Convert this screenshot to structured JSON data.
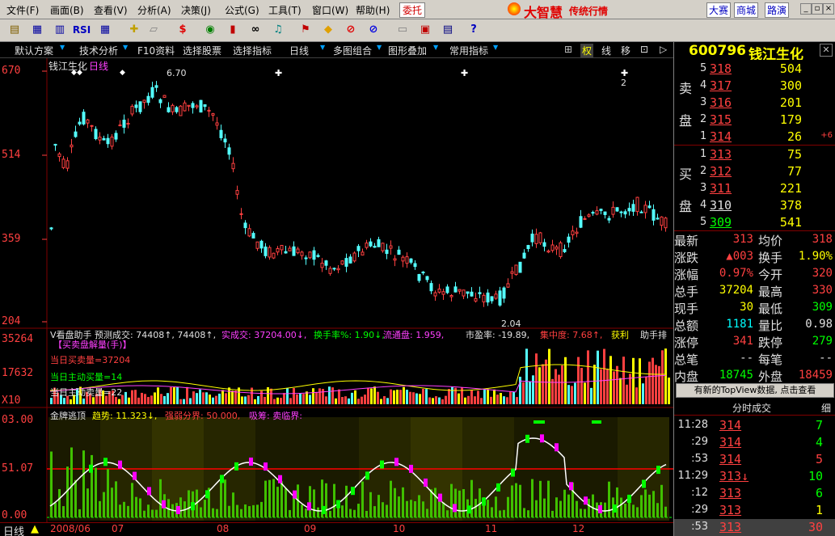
{
  "menu": [
    "文件(F)",
    "画面(B)",
    "查看(V)",
    "分析(A)",
    "决策(J)",
    "公式(G)",
    "工具(T)",
    "窗口(W)",
    "帮助(H)"
  ],
  "menu_entrust": "委托",
  "brand": "大智慧",
  "brand_sub": "传统行情",
  "menu_right": [
    "大赛",
    "商城",
    "路演"
  ],
  "toolbar_rsi": "RSI",
  "funcbar": [
    "默认方案",
    "技术分析",
    "F10资料",
    "选择股票",
    "选择指标",
    "日线",
    "多图组合",
    "图形叠加",
    "常用指标"
  ],
  "funcbar_right": [
    "⊞",
    "权",
    "线",
    "移",
    "⊡",
    "▷"
  ],
  "stock": {
    "code": "600796",
    "name": "钱江生化"
  },
  "chart": {
    "title_name": "钱江生化",
    "title_period": "日线",
    "y_labels": [
      "670",
      "514",
      "359",
      "204"
    ],
    "high_label": "6.70",
    "low_label": "2.04",
    "marker_2": "2"
  },
  "vol_panel": {
    "y_labels": [
      "35264",
      "17632",
      "X10"
    ],
    "header": [
      "V看盘助手 预测成交: 74408↑, 74408↑,",
      "实成交: 37204.00↓,",
      "换手率%: 1.90↓,",
      "流通盘: 1.959,",
      "市盈率: -19.89,",
      "集中度: 7.68↑,",
      "获利",
      "助手排"
    ],
    "lines": [
      "【买卖盘解量(手)】",
      "当日买卖量=37204",
      "当日主动买量=14",
      "当日主动卖量=22"
    ]
  },
  "ind_panel": {
    "y_labels": [
      "03.00",
      "51.07",
      "0.00"
    ],
    "header": [
      "金牌逃顶",
      "趋势: 11.323↓,",
      "强弱分界: 50.000,",
      "吸筹: 卖临界:"
    ]
  },
  "x_labels": [
    "2008/06",
    "07",
    "08",
    "09",
    "10",
    "11",
    "12"
  ],
  "status_left": "日线",
  "orderbook": {
    "sell_label": [
      "卖",
      "盘"
    ],
    "buy_label": [
      "买",
      "盘"
    ],
    "sell": [
      {
        "idx": "5",
        "price": "318",
        "vol": "504",
        "color": "#ff4040"
      },
      {
        "idx": "4",
        "price": "317",
        "vol": "300",
        "color": "#ff4040"
      },
      {
        "idx": "3",
        "price": "316",
        "vol": "201",
        "color": "#ff4040"
      },
      {
        "idx": "2",
        "price": "315",
        "vol": "179",
        "color": "#ff4040"
      },
      {
        "idx": "1",
        "price": "314",
        "vol": "26",
        "color": "#ff4040"
      }
    ],
    "sell_change": "+6",
    "buy": [
      {
        "idx": "1",
        "price": "313",
        "vol": "75",
        "color": "#ff4040"
      },
      {
        "idx": "2",
        "price": "312",
        "vol": "77",
        "color": "#ff4040"
      },
      {
        "idx": "3",
        "price": "311",
        "vol": "221",
        "color": "#ff4040"
      },
      {
        "idx": "4",
        "price": "310",
        "vol": "378",
        "color": "#e0e0e0"
      },
      {
        "idx": "5",
        "price": "309",
        "vol": "541",
        "color": "#00ff00"
      }
    ]
  },
  "quote": [
    {
      "l1": "最新",
      "v1": "313",
      "c1": "#ff4040",
      "l2": "均价",
      "v2": "318",
      "c2": "#ff4040"
    },
    {
      "l1": "涨跌",
      "v1": "▲003",
      "c1": "#ff4040",
      "l2": "换手",
      "v2": "1.90%",
      "c2": "#ffff00"
    },
    {
      "l1": "涨幅",
      "v1": "0.97%",
      "c1": "#ff4040",
      "l2": "今开",
      "v2": "320",
      "c2": "#ff4040"
    },
    {
      "l1": "总手",
      "v1": "37204",
      "c1": "#ffff00",
      "l2": "最高",
      "v2": "330",
      "c2": "#ff4040"
    },
    {
      "l1": "现手",
      "v1": "30",
      "c1": "#ffff00",
      "l2": "最低",
      "v2": "309",
      "c2": "#00ff00"
    },
    {
      "l1": "总额",
      "v1": "1181",
      "c1": "#00ffff",
      "l2": "量比",
      "v2": "0.98",
      "c2": "#e0e0e0"
    },
    {
      "l1": "涨停",
      "v1": "341",
      "c1": "#ff4040",
      "l2": "跌停",
      "v2": "279",
      "c2": "#00ff00"
    },
    {
      "l1": "总笔",
      "v1": "--",
      "c1": "#e0e0e0",
      "l2": "每笔",
      "v2": "--",
      "c2": "#e0e0e0"
    },
    {
      "l1": "内盘",
      "v1": "18745",
      "c1": "#00ff00",
      "l2": "外盘",
      "v2": "18459",
      "c2": "#ff4040"
    }
  ],
  "topview_btn": "有新的TopView数据, 点击查看",
  "ticks_header": "分时成交",
  "ticks_header_right": "细",
  "ticks": [
    {
      "time": "11:28",
      "price": "314",
      "vol": "7",
      "vc": "#00ff00"
    },
    {
      "time": ":29",
      "price": "314",
      "vol": "4",
      "vc": "#00ff00"
    },
    {
      "time": ":53",
      "price": "314",
      "vol": "5",
      "vc": "#ff4040"
    },
    {
      "time": "11:29",
      "price": "313↓",
      "vol": "10",
      "vc": "#00ff00"
    },
    {
      "time": ":12",
      "price": "313",
      "vol": "6",
      "vc": "#00ff00"
    },
    {
      "time": ":29",
      "price": "313",
      "vol": "1",
      "vc": "#ffff00"
    },
    {
      "time": ":53",
      "price": "313",
      "vol": "30",
      "vc": "#ff4040"
    }
  ],
  "colors": {
    "up": "#ff4040",
    "down": "#54ffff",
    "bg": "#000000",
    "grid": "#800000"
  }
}
